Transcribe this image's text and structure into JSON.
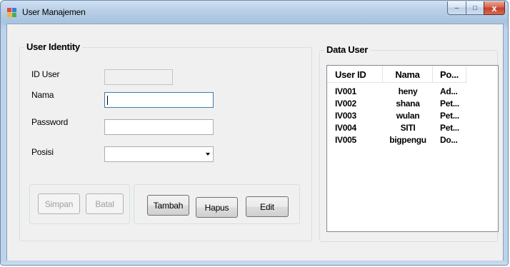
{
  "window": {
    "title": "User Manajemen",
    "controls": {
      "minimize": "–",
      "maximize": "□",
      "close": "x"
    }
  },
  "identity": {
    "group_title": "User Identity",
    "id_label": "ID User",
    "id_value": "",
    "nama_label": "Nama",
    "nama_value": "",
    "password_label": "Password",
    "password_value": "",
    "posisi_label": "Posisi",
    "posisi_value": "",
    "buttons": {
      "simpan": "Simpan",
      "batal": "Batal",
      "tambah": "Tambah",
      "hapus": "Hapus",
      "edit": "Edit"
    }
  },
  "data_user": {
    "group_title": "Data User",
    "columns": [
      "User ID",
      "Nama",
      "Po..."
    ],
    "rows": [
      [
        "IV001",
        "heny",
        "Ad..."
      ],
      [
        "IV002",
        "shana",
        "Pet..."
      ],
      [
        "IV003",
        "wulan",
        "Pet..."
      ],
      [
        "IV004",
        "SITI",
        "Pet..."
      ],
      [
        "IV005",
        "bigpengu",
        "Do..."
      ]
    ]
  },
  "colors": {
    "titlebar": "#b9cfe7",
    "close_button": "#c5402a",
    "form_background": "#f0f0f0"
  }
}
